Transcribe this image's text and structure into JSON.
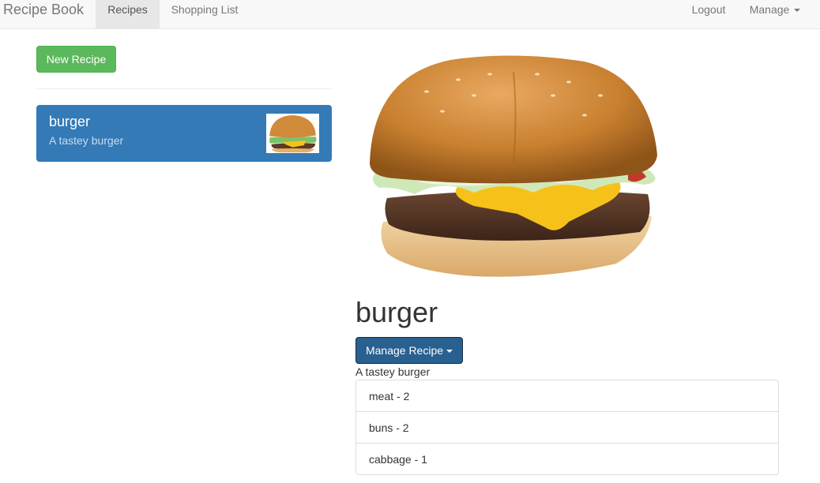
{
  "navbar": {
    "brand": "Recipe Book",
    "links": [
      "Recipes",
      "Shopping List"
    ],
    "logout": "Logout",
    "manage": "Manage"
  },
  "left": {
    "new_recipe_label": "New Recipe",
    "recipe": {
      "name": "burger",
      "description": "A tastey burger"
    }
  },
  "detail": {
    "title": "burger",
    "manage_label": "Manage Recipe",
    "description": "A tastey burger",
    "ingredients": [
      "meat - 2",
      "buns - 2",
      "cabbage - 1"
    ]
  },
  "colors": {
    "brand_green": "#5cb85c",
    "primary_blue": "#337ab7",
    "button_dark_blue": "#286090"
  },
  "icons": [
    "caret-down-icon",
    "burger-image"
  ]
}
